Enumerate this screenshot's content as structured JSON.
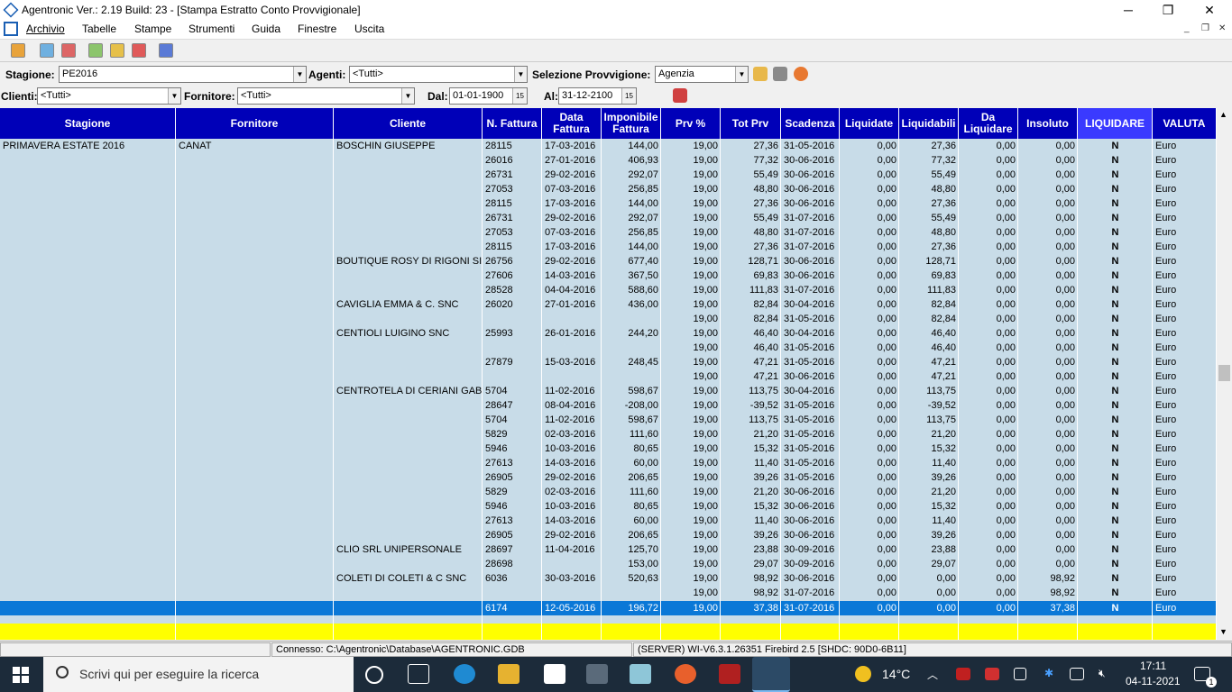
{
  "window": {
    "title": "Agentronic Ver.: 2.19 Build: 23  - [Stampa Estratto Conto Provvigionale]",
    "minimize": "─",
    "maximize": "❐",
    "close": "✕"
  },
  "menu": [
    "Archivio",
    "Tabelle",
    "Stampe",
    "Strumenti",
    "Guida",
    "Finestre",
    "Uscita"
  ],
  "filters": {
    "stagione_label": "Stagione:",
    "stagione_value": "PE2016",
    "agenti_label": "Agenti:",
    "agenti_value": "<Tutti>",
    "selprov_label": "Selezione Provvigione:",
    "selprov_value": "Agenzia",
    "clienti_label": "Clienti:",
    "clienti_value": "<Tutti>",
    "fornitore_label": "Fornitore:",
    "fornitore_value": "<Tutti>",
    "dal_label": "Dal:",
    "dal_value": "01-01-1900",
    "al_label": "Al:",
    "al_value": "31-12-2100",
    "calendar_label": "15"
  },
  "columns": [
    "Stagione",
    "Fornitore",
    "Cliente",
    "N. Fattura",
    "Data Fattura",
    "Imponibile Fattura",
    "Prv %",
    "Tot Prv",
    "Scadenza",
    "Liquidate",
    "Liquidabili",
    "Da Liquidare",
    "Insoluto",
    "LIQUIDARE",
    "VALUTA"
  ],
  "rows": [
    [
      "PRIMAVERA ESTATE 2016",
      "CANAT",
      "BOSCHIN GIUSEPPE",
      "28115",
      "17-03-2016",
      "144,00",
      "19,00",
      "27,36",
      "31-05-2016",
      "0,00",
      "27,36",
      "0,00",
      "0,00",
      "N",
      "Euro"
    ],
    [
      "",
      "",
      "",
      "26016",
      "27-01-2016",
      "406,93",
      "19,00",
      "77,32",
      "30-06-2016",
      "0,00",
      "77,32",
      "0,00",
      "0,00",
      "N",
      "Euro"
    ],
    [
      "",
      "",
      "",
      "26731",
      "29-02-2016",
      "292,07",
      "19,00",
      "55,49",
      "30-06-2016",
      "0,00",
      "55,49",
      "0,00",
      "0,00",
      "N",
      "Euro"
    ],
    [
      "",
      "",
      "",
      "27053",
      "07-03-2016",
      "256,85",
      "19,00",
      "48,80",
      "30-06-2016",
      "0,00",
      "48,80",
      "0,00",
      "0,00",
      "N",
      "Euro"
    ],
    [
      "",
      "",
      "",
      "28115",
      "17-03-2016",
      "144,00",
      "19,00",
      "27,36",
      "30-06-2016",
      "0,00",
      "27,36",
      "0,00",
      "0,00",
      "N",
      "Euro"
    ],
    [
      "",
      "",
      "",
      "26731",
      "29-02-2016",
      "292,07",
      "19,00",
      "55,49",
      "31-07-2016",
      "0,00",
      "55,49",
      "0,00",
      "0,00",
      "N",
      "Euro"
    ],
    [
      "",
      "",
      "",
      "27053",
      "07-03-2016",
      "256,85",
      "19,00",
      "48,80",
      "31-07-2016",
      "0,00",
      "48,80",
      "0,00",
      "0,00",
      "N",
      "Euro"
    ],
    [
      "",
      "",
      "",
      "28115",
      "17-03-2016",
      "144,00",
      "19,00",
      "27,36",
      "31-07-2016",
      "0,00",
      "27,36",
      "0,00",
      "0,00",
      "N",
      "Euro"
    ],
    [
      "",
      "",
      "BOUTIQUE ROSY DI RIGONI SIL",
      "26756",
      "29-02-2016",
      "677,40",
      "19,00",
      "128,71",
      "30-06-2016",
      "0,00",
      "128,71",
      "0,00",
      "0,00",
      "N",
      "Euro"
    ],
    [
      "",
      "",
      "",
      "27606",
      "14-03-2016",
      "367,50",
      "19,00",
      "69,83",
      "30-06-2016",
      "0,00",
      "69,83",
      "0,00",
      "0,00",
      "N",
      "Euro"
    ],
    [
      "",
      "",
      "",
      "28528",
      "04-04-2016",
      "588,60",
      "19,00",
      "111,83",
      "31-07-2016",
      "0,00",
      "111,83",
      "0,00",
      "0,00",
      "N",
      "Euro"
    ],
    [
      "",
      "",
      "CAVIGLIA EMMA & C. SNC",
      "26020",
      "27-01-2016",
      "436,00",
      "19,00",
      "82,84",
      "30-04-2016",
      "0,00",
      "82,84",
      "0,00",
      "0,00",
      "N",
      "Euro"
    ],
    [
      "",
      "",
      "",
      "",
      "",
      "",
      "19,00",
      "82,84",
      "31-05-2016",
      "0,00",
      "82,84",
      "0,00",
      "0,00",
      "N",
      "Euro"
    ],
    [
      "",
      "",
      "CENTIOLI LUIGINO SNC",
      "25993",
      "26-01-2016",
      "244,20",
      "19,00",
      "46,40",
      "30-04-2016",
      "0,00",
      "46,40",
      "0,00",
      "0,00",
      "N",
      "Euro"
    ],
    [
      "",
      "",
      "",
      "",
      "",
      "",
      "19,00",
      "46,40",
      "31-05-2016",
      "0,00",
      "46,40",
      "0,00",
      "0,00",
      "N",
      "Euro"
    ],
    [
      "",
      "",
      "",
      "27879",
      "15-03-2016",
      "248,45",
      "19,00",
      "47,21",
      "31-05-2016",
      "0,00",
      "47,21",
      "0,00",
      "0,00",
      "N",
      "Euro"
    ],
    [
      "",
      "",
      "",
      "",
      "",
      "",
      "19,00",
      "47,21",
      "30-06-2016",
      "0,00",
      "47,21",
      "0,00",
      "0,00",
      "N",
      "Euro"
    ],
    [
      "",
      "",
      "CENTROTELA DI CERIANI GABR",
      "5704",
      "11-02-2016",
      "598,67",
      "19,00",
      "113,75",
      "30-04-2016",
      "0,00",
      "113,75",
      "0,00",
      "0,00",
      "N",
      "Euro"
    ],
    [
      "",
      "",
      "",
      "28647",
      "08-04-2016",
      "-208,00",
      "19,00",
      "-39,52",
      "31-05-2016",
      "0,00",
      "-39,52",
      "0,00",
      "0,00",
      "N",
      "Euro"
    ],
    [
      "",
      "",
      "",
      "5704",
      "11-02-2016",
      "598,67",
      "19,00",
      "113,75",
      "31-05-2016",
      "0,00",
      "113,75",
      "0,00",
      "0,00",
      "N",
      "Euro"
    ],
    [
      "",
      "",
      "",
      "5829",
      "02-03-2016",
      "111,60",
      "19,00",
      "21,20",
      "31-05-2016",
      "0,00",
      "21,20",
      "0,00",
      "0,00",
      "N",
      "Euro"
    ],
    [
      "",
      "",
      "",
      "5946",
      "10-03-2016",
      "80,65",
      "19,00",
      "15,32",
      "31-05-2016",
      "0,00",
      "15,32",
      "0,00",
      "0,00",
      "N",
      "Euro"
    ],
    [
      "",
      "",
      "",
      "27613",
      "14-03-2016",
      "60,00",
      "19,00",
      "11,40",
      "31-05-2016",
      "0,00",
      "11,40",
      "0,00",
      "0,00",
      "N",
      "Euro"
    ],
    [
      "",
      "",
      "",
      "26905",
      "29-02-2016",
      "206,65",
      "19,00",
      "39,26",
      "31-05-2016",
      "0,00",
      "39,26",
      "0,00",
      "0,00",
      "N",
      "Euro"
    ],
    [
      "",
      "",
      "",
      "5829",
      "02-03-2016",
      "111,60",
      "19,00",
      "21,20",
      "30-06-2016",
      "0,00",
      "21,20",
      "0,00",
      "0,00",
      "N",
      "Euro"
    ],
    [
      "",
      "",
      "",
      "5946",
      "10-03-2016",
      "80,65",
      "19,00",
      "15,32",
      "30-06-2016",
      "0,00",
      "15,32",
      "0,00",
      "0,00",
      "N",
      "Euro"
    ],
    [
      "",
      "",
      "",
      "27613",
      "14-03-2016",
      "60,00",
      "19,00",
      "11,40",
      "30-06-2016",
      "0,00",
      "11,40",
      "0,00",
      "0,00",
      "N",
      "Euro"
    ],
    [
      "",
      "",
      "",
      "26905",
      "29-02-2016",
      "206,65",
      "19,00",
      "39,26",
      "30-06-2016",
      "0,00",
      "39,26",
      "0,00",
      "0,00",
      "N",
      "Euro"
    ],
    [
      "",
      "",
      "CLIO SRL UNIPERSONALE",
      "28697",
      "11-04-2016",
      "125,70",
      "19,00",
      "23,88",
      "30-09-2016",
      "0,00",
      "23,88",
      "0,00",
      "0,00",
      "N",
      "Euro"
    ],
    [
      "",
      "",
      "",
      "28698",
      "",
      "153,00",
      "19,00",
      "29,07",
      "30-09-2016",
      "0,00",
      "29,07",
      "0,00",
      "0,00",
      "N",
      "Euro"
    ],
    [
      "",
      "",
      "COLETI DI COLETI & C SNC",
      "6036",
      "30-03-2016",
      "520,63",
      "19,00",
      "98,92",
      "30-06-2016",
      "0,00",
      "0,00",
      "0,00",
      "98,92",
      "N",
      "Euro"
    ],
    [
      "",
      "",
      "",
      "",
      "",
      "",
      "19,00",
      "98,92",
      "31-07-2016",
      "0,00",
      "0,00",
      "0,00",
      "98,92",
      "N",
      "Euro"
    ],
    [
      "",
      "",
      "",
      "6174",
      "12-05-2016",
      "196,72",
      "19,00",
      "37,38",
      "31-07-2016",
      "0,00",
      "0,00",
      "0,00",
      "37,38",
      "N",
      "Euro"
    ]
  ],
  "status": {
    "connection": "Connesso: C:\\Agentronic\\Database\\AGENTRONIC.GDB",
    "server": "(SERVER) WI-V6.3.1.26351 Firebird 2.5 [SHDC: 90D0-6B11]"
  },
  "taskbar": {
    "search_placeholder": "Scrivi qui per eseguire la ricerca",
    "temperature": "14°C",
    "time": "17:11",
    "date": "04-11-2021",
    "notif_count": "1"
  }
}
